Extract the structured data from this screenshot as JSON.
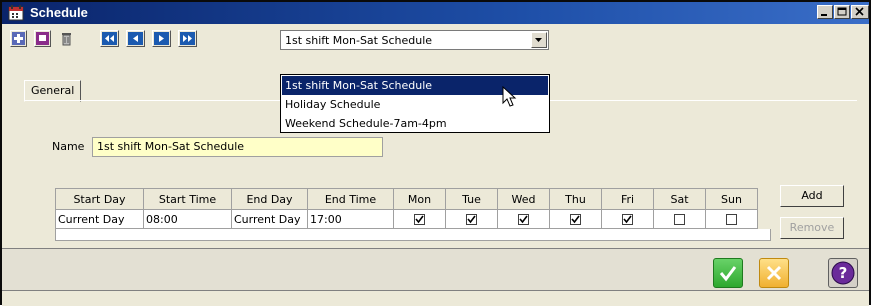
{
  "window": {
    "title": "Schedule",
    "controls": [
      "minimize-icon",
      "maximize-icon",
      "close-icon"
    ]
  },
  "toolbar": {
    "buttons": [
      "add-record-icon",
      "save-record-icon",
      "delete-record-icon",
      "first-record-icon",
      "previous-record-icon",
      "next-record-icon",
      "last-record-icon"
    ],
    "schedule_select": {
      "value": "1st shift Mon-Sat Schedule",
      "options": [
        "1st shift Mon-Sat Schedule",
        "Holiday Schedule",
        "Weekend Schedule-7am-4pm"
      ]
    }
  },
  "tabs": [
    {
      "label": "General"
    }
  ],
  "form": {
    "name_label": "Name",
    "name_value": "1st shift Mon-Sat Schedule"
  },
  "grid": {
    "columns": [
      "Start Day",
      "Start Time",
      "End Day",
      "End Time",
      "Mon",
      "Tue",
      "Wed",
      "Thu",
      "Fri",
      "Sat",
      "Sun"
    ],
    "rows": [
      {
        "start_day": "Current Day",
        "start_time": "08:00",
        "end_day": "Current Day",
        "end_time": "17:00",
        "days": [
          true,
          true,
          true,
          true,
          true,
          false,
          false
        ]
      }
    ]
  },
  "side_buttons": {
    "add": "Add",
    "remove": "Remove"
  },
  "bottom": {
    "ok_icon": "checkmark-icon",
    "cancel_icon": "cancel-icon",
    "help_icon": "help-icon",
    "help_glyph": "?"
  },
  "colors": {
    "titlebar": "#0a246a",
    "selection": "#0a246a",
    "name_field": "#ffffc8",
    "ok_green": "#3cb83c",
    "cancel_yellow": "#f3c64a",
    "help_purple": "#6a2a9a"
  }
}
